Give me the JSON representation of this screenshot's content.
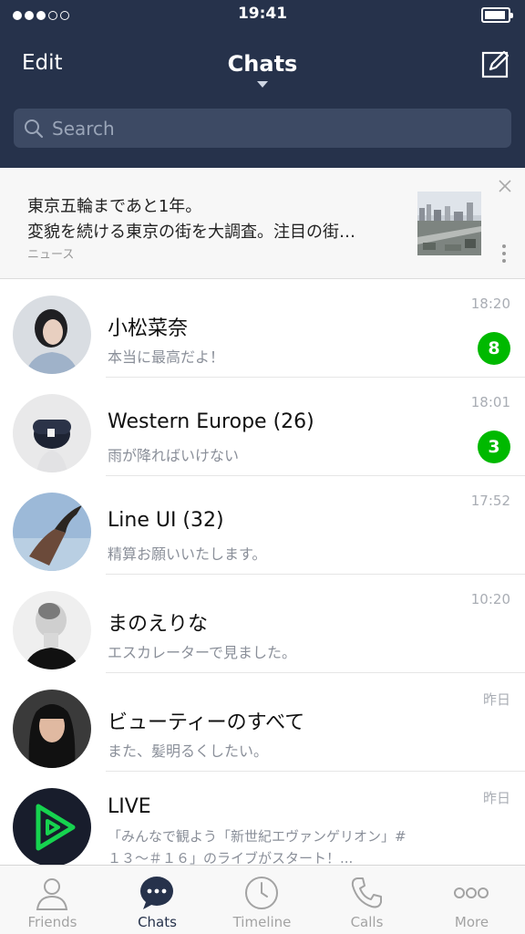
{
  "status_bar": {
    "time": "19:41"
  },
  "nav": {
    "edit_label": "Edit",
    "title": "Chats"
  },
  "search": {
    "placeholder": "Search"
  },
  "news": {
    "line1": "東京五輪まであと1年。",
    "line2": "変貌を続ける東京の街を大調査。注目の街…",
    "source": "ニュース"
  },
  "chats": [
    {
      "name": "小松菜奈",
      "preview": "本当に最高だよ！",
      "time": "18:20",
      "badge": "8"
    },
    {
      "name": "Western Europe (26)",
      "preview": "雨が降ればいけない",
      "time": "18:01",
      "badge": "3"
    },
    {
      "name": "Line UI (32)",
      "preview": "精算お願いいたします。",
      "time": "17:52"
    },
    {
      "name": "まのえりな",
      "preview": "エスカレーターで見ました。",
      "time": "10:20"
    },
    {
      "name": "ビューティーのすべて",
      "preview": "また、髪明るくしたい。",
      "time": "昨日"
    },
    {
      "name": "LIVE",
      "preview": "「みんなで観よう「新世紀エヴァンゲリオン」#",
      "preview2": "１３～＃１６」のライブがスタート！...",
      "time": "昨日"
    }
  ],
  "tabs": [
    {
      "label": "Friends",
      "icon": "person-icon"
    },
    {
      "label": "Chats",
      "icon": "chat-bubble-icon"
    },
    {
      "label": "Timeline",
      "icon": "clock-icon"
    },
    {
      "label": "Calls",
      "icon": "phone-icon"
    },
    {
      "label": "More",
      "icon": "more-icon"
    }
  ],
  "colors": {
    "header": "#26324b",
    "badge": "#00b900",
    "active_tab": "#26324b"
  }
}
